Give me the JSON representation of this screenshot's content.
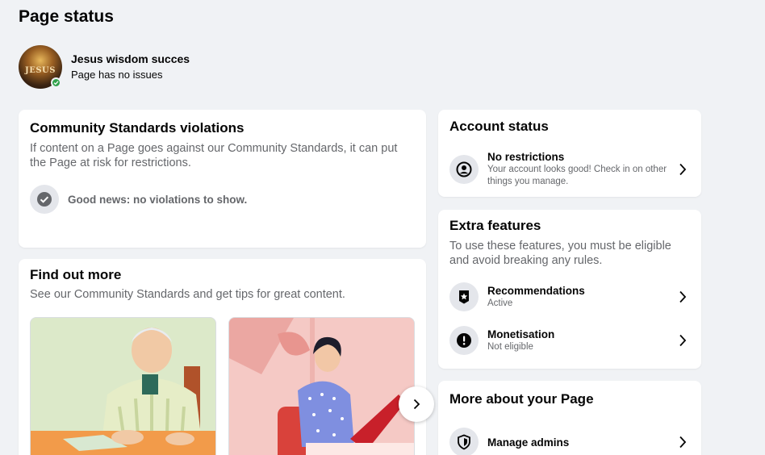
{
  "page": {
    "title": "Page status"
  },
  "profile": {
    "name": "Jesus wisdom succes",
    "status": "Page has no issues",
    "avatar_text": "JESUS"
  },
  "community_standards": {
    "title": "Community Standards violations",
    "description": "If content on a Page goes against our Community Standards, it can put the Page at risk for restrictions.",
    "good_news": "Good news: no violations to show."
  },
  "find_out_more": {
    "title": "Find out more",
    "description": "See our Community Standards and get tips for great content."
  },
  "account_status": {
    "title": "Account status",
    "item_title": "No restrictions",
    "item_sub": "Your account looks good! Check in on other things you manage."
  },
  "extra_features": {
    "title": "Extra features",
    "description": "To use these features, you must be eligible and avoid breaking any rules.",
    "items": [
      {
        "title": "Recommendations",
        "status": "Active",
        "icon": "star-badge-icon"
      },
      {
        "title": "Monetisation",
        "status": "Not eligible",
        "icon": "exclamation-icon"
      }
    ]
  },
  "more_about": {
    "title": "More about your Page",
    "items": [
      {
        "title": "Manage admins",
        "icon": "shield-icon"
      }
    ]
  },
  "colors": {
    "accent_green": "#31a24c",
    "secondary_text": "#65676b",
    "background": "#f0f2f5"
  }
}
